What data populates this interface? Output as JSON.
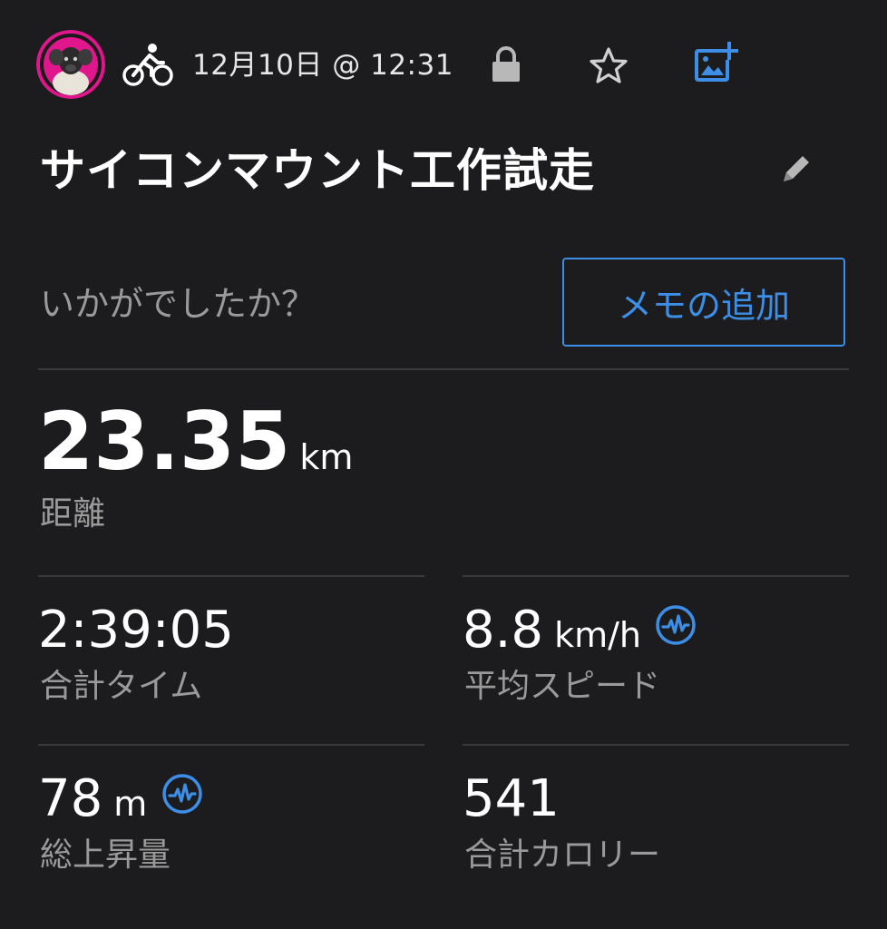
{
  "header": {
    "avatar_icon": "user-avatar",
    "activity_icon": "cycling-icon",
    "date": "12月10日 @ 12:31",
    "privacy_icon": "lock-icon",
    "favorite_icon": "star-icon",
    "add_photo_icon": "add-photo-icon"
  },
  "activity": {
    "title": "サイコンマウント工作試走",
    "edit_icon": "pencil-icon"
  },
  "notes": {
    "prompt": "いかがでしたか？",
    "add_memo_label": "メモの追加"
  },
  "distance": {
    "value": "23.35",
    "unit": "km",
    "label": "距離"
  },
  "stats": {
    "total_time": {
      "value": "2:39:05",
      "label": "合計タイム"
    },
    "avg_speed": {
      "value": "8.8",
      "unit": "km/h",
      "label": "平均スピード",
      "icon": "pulse-badge-icon"
    },
    "elevation_gain": {
      "value": "78",
      "unit": "m",
      "label": "総上昇量",
      "icon": "pulse-badge-icon"
    },
    "calories": {
      "value": "541",
      "label": "合計カロリー"
    }
  },
  "colors": {
    "background": "#1c1c1e",
    "accent": "#3d8ee6",
    "secondary_text": "#9a9a9a",
    "avatar_ring": "#e0168c"
  }
}
